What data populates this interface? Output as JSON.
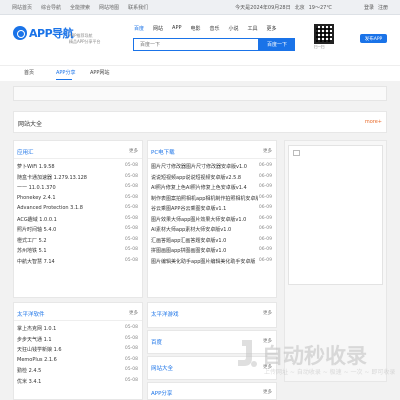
{
  "topbar": {
    "links": [
      "网站首页",
      "综合导航",
      "全能搜索",
      "网站地图",
      "联系我们"
    ],
    "date": "今天是2024年09月28日",
    "city": "北京",
    "weather": "19～27℃",
    "login": "登录",
    "register": "注册"
  },
  "header": {
    "logo_text": "APP导航",
    "slogan_line1": "APP推荐导航",
    "slogan_line2": "精品APP分享平台",
    "search_tabs": [
      "百度",
      "网站",
      "APP",
      "电影",
      "音乐",
      "小说",
      "工具",
      "更多"
    ],
    "search_placeholder": "百度一下",
    "search_button": "百度一下",
    "qrcode_text": "扫一扫",
    "submit_button": "发布APP"
  },
  "nav": {
    "items": [
      "首页",
      "APP分享",
      "APP网站"
    ],
    "active_index": 1
  },
  "section": {
    "title": "网站大全",
    "more": "more+"
  },
  "cards": {
    "app_recommend": {
      "title": "应用汇",
      "more": "更多",
      "rows": [
        {
          "name": "萝卜WiFi 1.9.58",
          "date": "05-08"
        },
        {
          "name": "随盒卡通加速器 1.279.13.128",
          "date": "05-08"
        },
        {
          "name": "一一 11.0.1.370",
          "date": "05-08"
        },
        {
          "name": "Phonekey 2.4.1",
          "date": "05-08"
        },
        {
          "name": "Advanced Protection 3.1.8",
          "date": "05-08"
        },
        {
          "name": "ACG趣域 1.0.0.1",
          "date": "05-08"
        },
        {
          "name": "照片时间轴 5.4.0",
          "date": "05-08"
        },
        {
          "name": "橙式工厂 5.2",
          "date": "05-08"
        },
        {
          "name": "苏州地铁 5.1",
          "date": "05-08"
        },
        {
          "name": "中航大智慧 7.14",
          "date": "05-08"
        }
      ]
    },
    "pc_download": {
      "title": "PC电下载",
      "more": "更多",
      "rows": [
        {
          "name": "图片尺寸修改器图片尺寸修改器安卓版v1.0",
          "date": "06-09"
        },
        {
          "name": "说说短视频app说说短视频安卓版v2.5.8",
          "date": "06-09"
        },
        {
          "name": "AI照片修复上色AI照片修复上色安卓版v1.4",
          "date": "06-09"
        },
        {
          "name": "制作表图案拍照相机app相机制作拍照相机安卓版v1.0",
          "date": "06-09"
        },
        {
          "name": "谷云乘图APP谷云乘图安卓版v1.1",
          "date": "06-09"
        },
        {
          "name": "图片效果大师app图片效果大师安卓版v1.0",
          "date": "06-09"
        },
        {
          "name": "AI素材大师app素材大师安卓版v1.0",
          "date": "06-09"
        },
        {
          "name": "汇画答题app汇画答题安卓版v1.0",
          "date": "06-09"
        },
        {
          "name": "拼图画图app拼图画图安卓版v1.0",
          "date": "06-09"
        },
        {
          "name": "图片编辑美化助手app图片编辑美化助手安卓版",
          "date": "06-09"
        }
      ]
    },
    "taiping": {
      "title": "太平洋软件",
      "more": "更多",
      "rows": [
        {
          "name": "掌上杰克网 1.0.1",
          "date": "05-08"
        },
        {
          "name": "步步天气通 1.1",
          "date": "05-08"
        },
        {
          "name": "天狂山钱学新娘 1.6",
          "date": "05-08"
        },
        {
          "name": "MemoPlus 2.1.6",
          "date": "05-08"
        },
        {
          "name": "勤检 2.4.5",
          "date": "05-08"
        },
        {
          "name": "优米 3.4.1",
          "date": "05-08"
        }
      ]
    },
    "taiping_site": {
      "title": "太平洋游戏",
      "more": "更多"
    },
    "pcsite": {
      "title": "百度",
      "more": "更多"
    },
    "site_big": {
      "title": "网站大全",
      "more": "更多"
    },
    "app_share": {
      "title": "APP分享",
      "more": "更多"
    }
  },
  "watermark": {
    "main": "自动秒收录",
    "sub": "上传网址 ~ 自动收录 ~ 极速 ~ 一次 ~ 即可收录"
  }
}
